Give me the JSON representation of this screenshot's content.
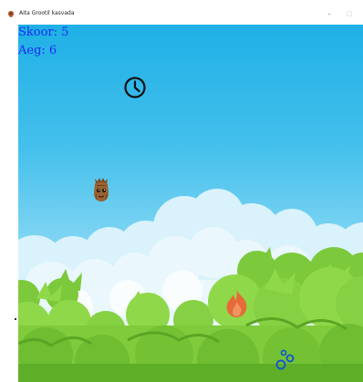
{
  "window": {
    "title": "Aita Grootil kasvada",
    "minimize_label": "–",
    "maximize_label": "□"
  },
  "hud": {
    "score_text": "Skoor: 5",
    "time_text": "Aeg: 6"
  },
  "colors": {
    "hud_text": "#1c2bf2",
    "sky_top": "#1fb0e6",
    "sky_bottom": "#d2f0fb",
    "bush_light": "#8fd84a",
    "bush_dark": "#4f9c1f",
    "fire": "#e66a3a"
  },
  "sprites": {
    "clock": "clock-icon",
    "player": "groot-icon",
    "hazard": "fire-icon",
    "water": "bubbles-icon"
  }
}
